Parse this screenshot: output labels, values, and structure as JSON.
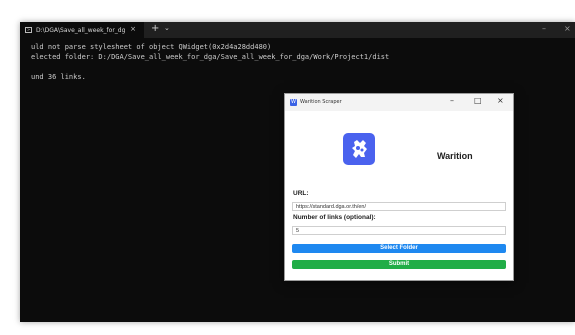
{
  "terminal": {
    "tab_title": "D:\\DGA\\Save_all_week_for_dg",
    "tab_close": "×",
    "new_tab": "+",
    "dropdown": "⌄",
    "win_minimize": "–",
    "win_close": "×",
    "lines": [
      "uld not parse stylesheet of object QWidget(0x2d4a28dd480)",
      "elected folder: D:/DGA/Save_all_week_for_dga/Save_all_week_for_dga/Work/Project1/dist",
      "",
      "und 36 links."
    ]
  },
  "app": {
    "title": "Warition Scraper",
    "minimize": "–",
    "maximize": "□",
    "close": "×",
    "brand": "Warition",
    "url_label": "URL:",
    "url_value": "https://standard.dga.or.th/en/",
    "links_label": "Number of links (optional):",
    "links_value": "5",
    "select_folder": "Select Folder",
    "submit": "Submit",
    "colors": {
      "logo_bg": "#4a62ee",
      "select_folder_bg": "#1e88f0",
      "submit_bg": "#21ad47"
    }
  }
}
